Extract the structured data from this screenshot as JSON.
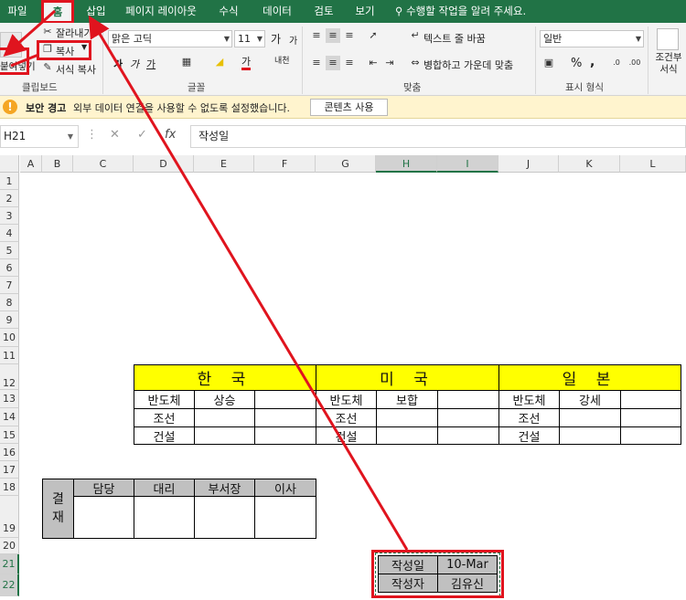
{
  "tabs": [
    "파일",
    "홈",
    "삽입",
    "페이지 레이아웃",
    "수식",
    "데이터",
    "검토",
    "보기"
  ],
  "tell_me": "수행할 작업을 알려 주세요.",
  "clipboard": {
    "paste": "붙여넣기",
    "cut": "잘라내기",
    "copy": "복사",
    "format_painter": "서식 복사",
    "label": "클립보드"
  },
  "font": {
    "name": "맑은 고딕",
    "size": "11",
    "grow": "가",
    "shrink": "가",
    "bold": "가",
    "italic": "가",
    "underline": "가",
    "font_color": "가",
    "phonetic": "내천",
    "label": "글꼴"
  },
  "alignment": {
    "wrap_text": "텍스트 줄 바꿈",
    "merge_center": "병합하고 가운데 맞춤",
    "label": "맞춤"
  },
  "number": {
    "format": "일반",
    "percent": "%",
    "comma": ",",
    "label": "표시 형식"
  },
  "styles": {
    "conditional": "조건부 서식"
  },
  "security": {
    "title": "보안 경고",
    "message": "외부 데이터 연결을 사용할 수 없도록 설정했습니다.",
    "button": "콘텐츠 사용"
  },
  "formula_bar": {
    "name_box": "H21",
    "content": "작성일"
  },
  "columns": [
    "A",
    "B",
    "C",
    "D",
    "E",
    "F",
    "G",
    "H",
    "I",
    "J",
    "K",
    "L"
  ],
  "rows": [
    "1",
    "2",
    "3",
    "4",
    "5",
    "6",
    "7",
    "8",
    "9",
    "10",
    "11",
    "12",
    "13",
    "14",
    "15",
    "16",
    "17",
    "18",
    "19",
    "20",
    "21",
    "22"
  ],
  "sheet": {
    "korea": "한 국",
    "usa": "미 국",
    "japan": "일 본",
    "k_r13": [
      "반도체",
      "상승",
      ""
    ],
    "k_r14": [
      "조선",
      "",
      ""
    ],
    "k_r15": [
      "건설",
      "",
      ""
    ],
    "u_r13": [
      "반도체",
      "보합",
      ""
    ],
    "u_r14": [
      "조선",
      "",
      ""
    ],
    "u_r15": [
      "건설",
      "",
      ""
    ],
    "j_r13": [
      "반도체",
      "강세",
      ""
    ],
    "j_r14": [
      "조선",
      "",
      ""
    ],
    "j_r15": [
      "건설",
      "",
      ""
    ],
    "approval_label": "결\n재",
    "approval_cols": [
      "담당",
      "대리",
      "부서장",
      "이사"
    ],
    "written_date_label": "작성일",
    "written_date": "10-Mar",
    "author_label": "작성자",
    "author": "김유신"
  },
  "colors": {
    "excel_green": "#217346",
    "highlight_red": "#e0141e",
    "header_yellow": "#ffff00"
  }
}
